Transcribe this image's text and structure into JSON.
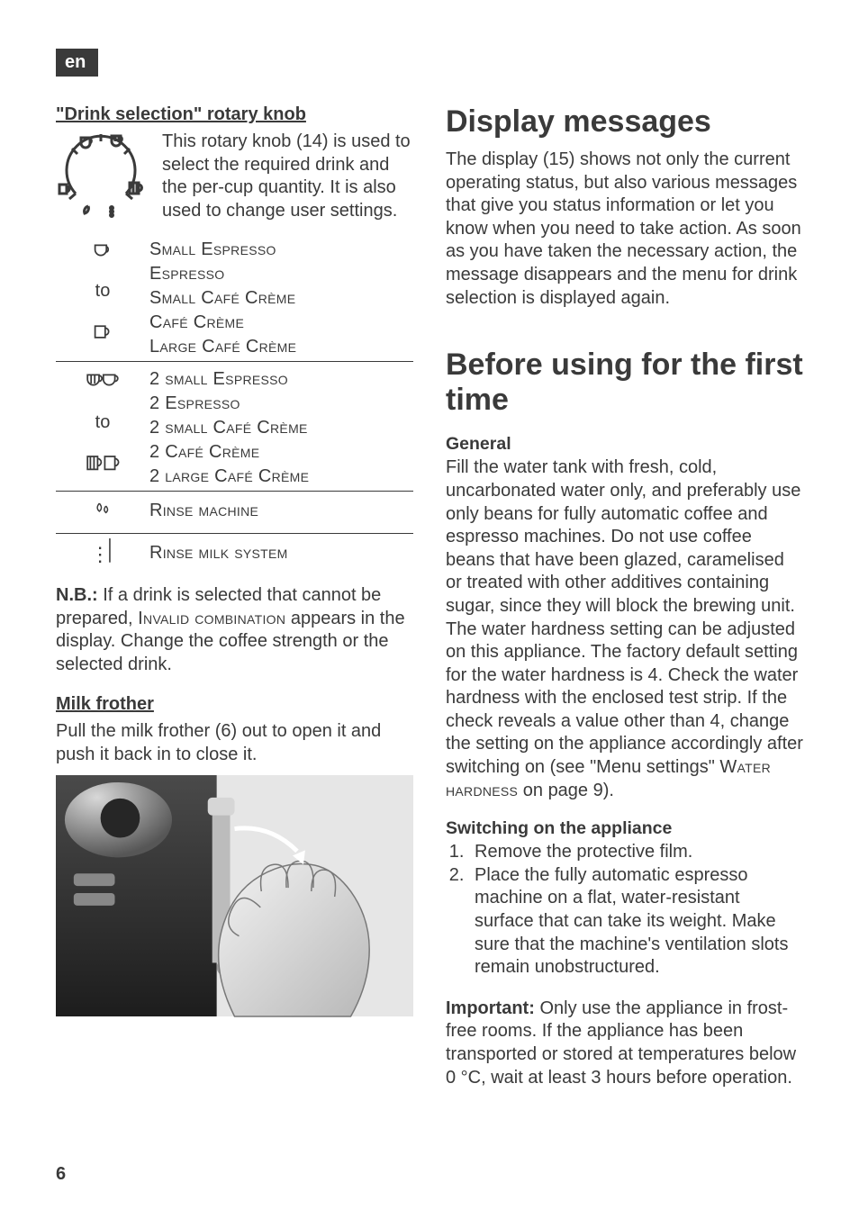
{
  "lang_tag": "en",
  "left": {
    "knob": {
      "heading": "\"Drink selection\" rotary knob",
      "intro": "This rotary knob (14) is used to select the required drink and the per-cup quantity. It is also used to change user settings."
    },
    "table": {
      "r1c1_to": "to",
      "r1_lines": {
        "a": "Small Espresso",
        "b": "Espresso",
        "c": "Small Café Crème",
        "d": "Café Crème",
        "e": "Large Café Crème"
      },
      "r2c1_to": "to",
      "r2_lines": {
        "a": "2 small Espresso",
        "b": "2 Espresso",
        "c": "2 small Café Crème",
        "d": "2 Café Crème",
        "e": "2 large Café Crème"
      },
      "r3": "Rinse machine",
      "r4": "Rinse milk system"
    },
    "nb_label": "N.B.:",
    "nb_text_a": " If a drink is selected that cannot be prepared, ",
    "nb_invalid": "Invalid combination",
    "nb_text_b": " appears in the display. Change the coffee strength or the selected drink.",
    "frother_heading": "Milk frother",
    "frother_text": "Pull the milk frother (6) out to open it and push it back in to close it."
  },
  "right": {
    "disp_heading": "Display messages",
    "disp_text": "The display (15) shows not only the current operating status, but also various messages that give you status information or let you know when you need to take action. As soon as you have taken the necessary action, the message disappears and the menu for drink selection is displayed again.",
    "before_heading": "Before using for the first time",
    "general_heading": "General",
    "general_text_a": "Fill the water tank with fresh, cold, uncarbonated water only, and preferably use only beans for fully automatic coffee and espresso machines. Do not use coffee beans that have been glazed, caramelised or treated with other additives containing sugar, since they will block the brewing unit. The water hardness setting can be adjusted on this appliance. The factory default setting for the water hardness is 4. Check the water hardness with the enclosed test strip. If the check reveals a value other than 4, change the setting on the appliance accordingly after switching on (see \"Menu settings\" ",
    "general_hardness": "Water hardness",
    "general_text_b": " on page 9).",
    "switch_heading": "Switching on the appliance",
    "switch_li1": "Remove the protective film.",
    "switch_li2": "Place the fully automatic espresso machine on a flat, water-resistant surface that can take its weight. Make sure that the machine's ventilation slots remain unobstructured.",
    "important_label": "Important:",
    "important_text": " Only use the appliance in frost-free rooms. If the appliance has been transported or stored at temperatures below 0 °C, wait at least 3 hours before operation."
  },
  "page_number": "6"
}
